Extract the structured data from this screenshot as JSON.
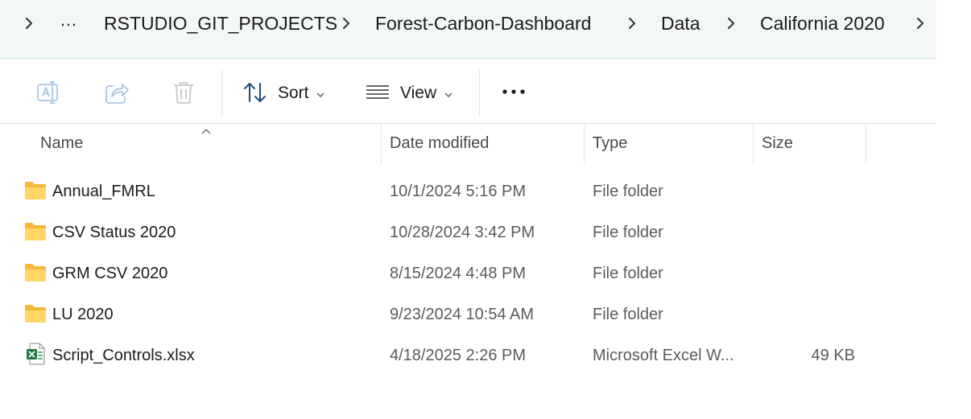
{
  "breadcrumb": {
    "overflow": "…",
    "items": [
      {
        "label": "RSTUDIO_GIT_PROJECTS"
      },
      {
        "label": "Forest-Carbon-Dashboard"
      },
      {
        "label": "Data"
      },
      {
        "label": "California 2020"
      }
    ]
  },
  "toolbar": {
    "sort_label": "Sort",
    "view_label": "View",
    "more_label": "•••",
    "icons": [
      "rename-icon",
      "share-icon",
      "delete-icon",
      "sort-icon",
      "view-icon",
      "more-icon"
    ]
  },
  "columns": {
    "name": "Name",
    "date": "Date modified",
    "type": "Type",
    "size": "Size",
    "sorted_by": "Name"
  },
  "files": [
    {
      "name": "Annual_FMRL",
      "date": "10/1/2024 5:16 PM",
      "type": "File folder",
      "size": "",
      "icon": "folder-icon"
    },
    {
      "name": "CSV Status 2020",
      "date": "10/28/2024 3:42 PM",
      "type": "File folder",
      "size": "",
      "icon": "folder-icon"
    },
    {
      "name": "GRM CSV 2020",
      "date": "8/15/2024 4:48 PM",
      "type": "File folder",
      "size": "",
      "icon": "folder-icon"
    },
    {
      "name": "LU 2020",
      "date": "9/23/2024 10:54 AM",
      "type": "File folder",
      "size": "",
      "icon": "folder-icon"
    },
    {
      "name": "Script_Controls.xlsx",
      "date": "4/18/2025 2:26 PM",
      "type": "Microsoft Excel W...",
      "size": "49 KB",
      "icon": "excel-file-icon"
    }
  ],
  "colors": {
    "address_bg": "#f3f7f5",
    "accent_line": "#c9e1d6",
    "folder": "#f7c948",
    "excel": "#1d7a45",
    "disabled_icon": "#a9c6e0"
  }
}
